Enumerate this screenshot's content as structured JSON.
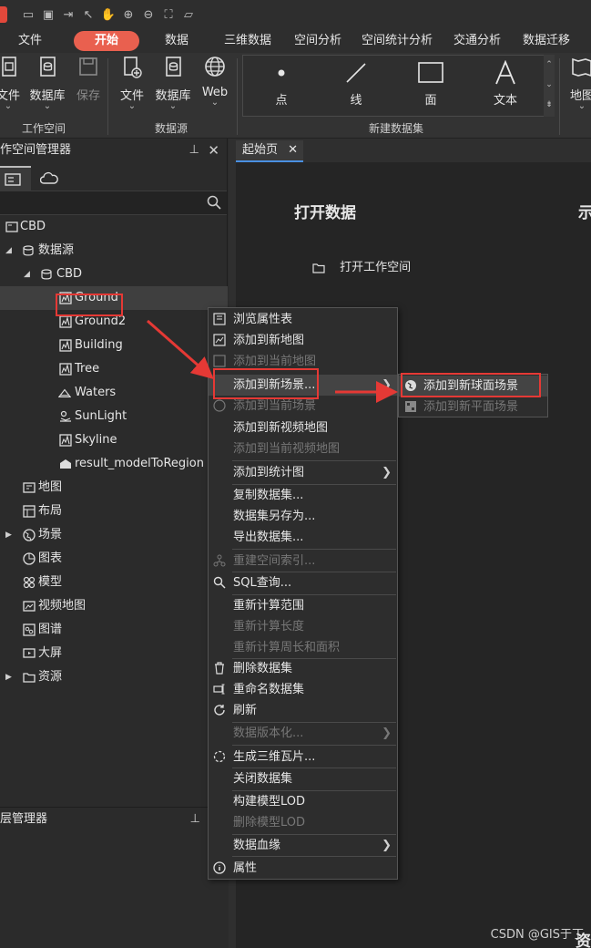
{
  "tabs": [
    "文件",
    "开始",
    "数据",
    "三维数据",
    "空间分析",
    "空间统计分析",
    "交通分析",
    "数据迁移"
  ],
  "ribbon": {
    "workspace_group": {
      "label": "工作空间",
      "file": "文件",
      "database": "数据库",
      "save": "保存"
    },
    "datasource_group": {
      "label": "数据源",
      "file": "文件",
      "database": "数据库",
      "web": "Web"
    },
    "newdataset_group": {
      "label": "新建数据集",
      "point": "点",
      "line": "线",
      "region": "面",
      "text": "文本"
    },
    "map_label": "地图"
  },
  "left_panel": {
    "title": "作空间管理器",
    "tree": {
      "root": "CBD",
      "datasources": "数据源",
      "cbd": "CBD",
      "datasets": [
        "Ground",
        "Ground2",
        "Building",
        "Tree",
        "Waters",
        "SunLight",
        "Skyline",
        "result_modelToRegion"
      ],
      "others": [
        "地图",
        "布局",
        "场景",
        "图表",
        "模型",
        "视频地图",
        "图谱",
        "大屏",
        "资源"
      ]
    },
    "layer_manager_title": "层管理器"
  },
  "doc": {
    "tab_label": "起始页",
    "open_data_title": "打开数据",
    "other_title": "示",
    "open_workspace": "打开工作空间"
  },
  "context_menu": {
    "items": [
      "浏览属性表",
      "添加到新地图",
      "添加到当前地图",
      "添加到新场景...",
      "添加到当前场景",
      "添加到新视频地图",
      "添加到当前视频地图",
      "添加到统计图",
      "复制数据集...",
      "数据集另存为...",
      "导出数据集...",
      "重建空间索引...",
      "SQL查询...",
      "重新计算范围",
      "重新计算长度",
      "重新计算周长和面积",
      "删除数据集",
      "重命名数据集",
      "刷新",
      "数据版本化...",
      "生成三维瓦片...",
      "关闭数据集",
      "构建模型LOD",
      "删除模型LOD",
      "数据血缘",
      "属性"
    ]
  },
  "submenu": {
    "items": [
      "添加到新球面场景",
      "添加到新平面场景"
    ]
  },
  "watermark": "CSDN @GIS于丁",
  "edge_char": "资",
  "colors": {
    "accent": "#e9604f",
    "highlight": "#e53935"
  }
}
